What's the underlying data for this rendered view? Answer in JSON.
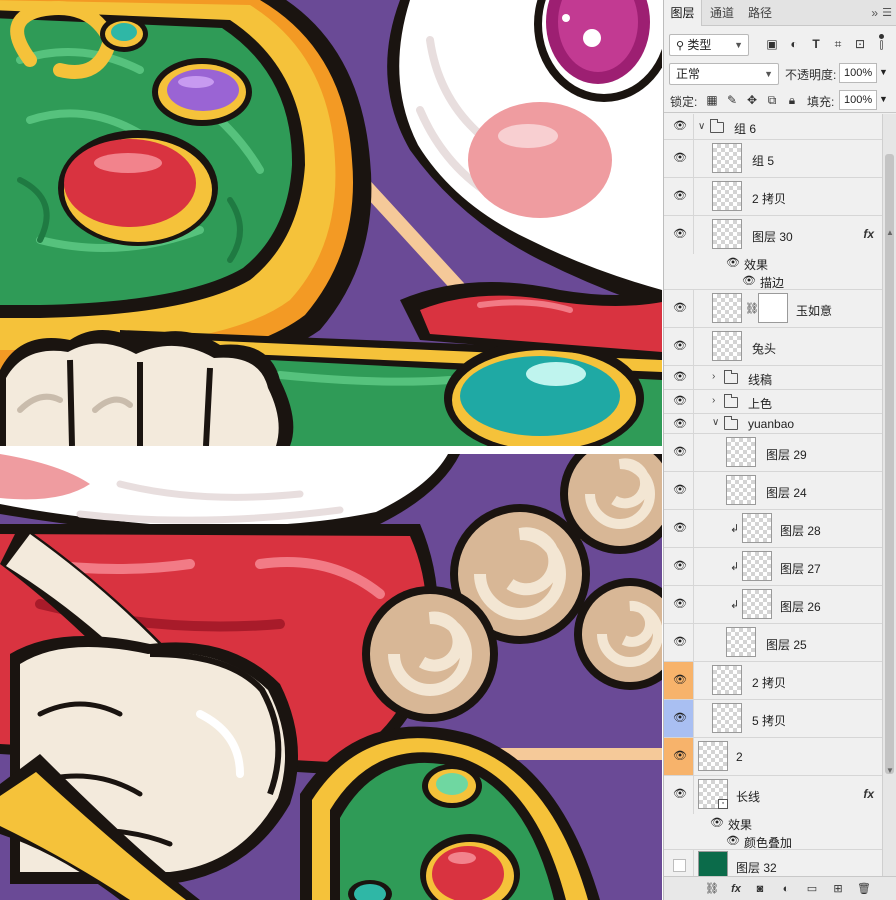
{
  "panel": {
    "tabs": [
      {
        "label": "图层",
        "active": true
      },
      {
        "label": "通道",
        "active": false
      },
      {
        "label": "路径",
        "active": false
      }
    ],
    "more_glyph": "»",
    "filter": {
      "kind_label": "类型"
    },
    "blend": {
      "mode": "正常",
      "opacity_label": "不透明度:",
      "opacity_value": "100%"
    },
    "lock": {
      "label": "锁定:",
      "fill_label": "填充:",
      "fill_value": "100%"
    },
    "layers": [
      {
        "name": "组 6",
        "kind": "group",
        "expanded": true
      },
      {
        "name": "组 5",
        "kind": "layer"
      },
      {
        "name": "2 拷贝",
        "kind": "layer"
      },
      {
        "name": "图层 30",
        "kind": "layer",
        "fx": true
      },
      {
        "name": "效果",
        "kind": "effects-header"
      },
      {
        "name": "描边",
        "kind": "effect"
      },
      {
        "name": "玉如意",
        "kind": "masked-layer"
      },
      {
        "name": "兔头",
        "kind": "layer"
      },
      {
        "name": "线稿",
        "kind": "group",
        "expanded": false
      },
      {
        "name": "上色",
        "kind": "group",
        "expanded": false
      },
      {
        "name": "yuanbao",
        "kind": "group",
        "expanded": true
      },
      {
        "name": "图层 29",
        "kind": "layer"
      },
      {
        "name": "图层 24",
        "kind": "layer"
      },
      {
        "name": "图层 28",
        "kind": "clipped-layer"
      },
      {
        "name": "图层 27",
        "kind": "clipped-layer"
      },
      {
        "name": "图层 26",
        "kind": "clipped-layer"
      },
      {
        "name": "图层 25",
        "kind": "layer"
      },
      {
        "name": "2 拷贝",
        "kind": "layer",
        "eye_color": "#f7b36b"
      },
      {
        "name": "5 拷贝",
        "kind": "layer",
        "eye_color": "#a9bff2"
      },
      {
        "name": "2",
        "kind": "layer",
        "eye_color": "#f7b36b"
      },
      {
        "name": "长线",
        "kind": "smart-object",
        "fx": true
      },
      {
        "name": "效果",
        "kind": "effects-header"
      },
      {
        "name": "颜色叠加",
        "kind": "effect"
      },
      {
        "name": "图层 32",
        "kind": "layer",
        "hidden": true
      }
    ],
    "fx_glyph": "fx"
  },
  "colors": {
    "purple_bg": "#6a4a96",
    "gold": "#f5c23a",
    "orange": "#f39a24",
    "green": "#2f9b57",
    "red": "#d93340",
    "pink": "#ef9ca0",
    "cream": "#f3eadc",
    "tan": "#d8b796",
    "layer32_thumb": "#0b6b4a"
  }
}
